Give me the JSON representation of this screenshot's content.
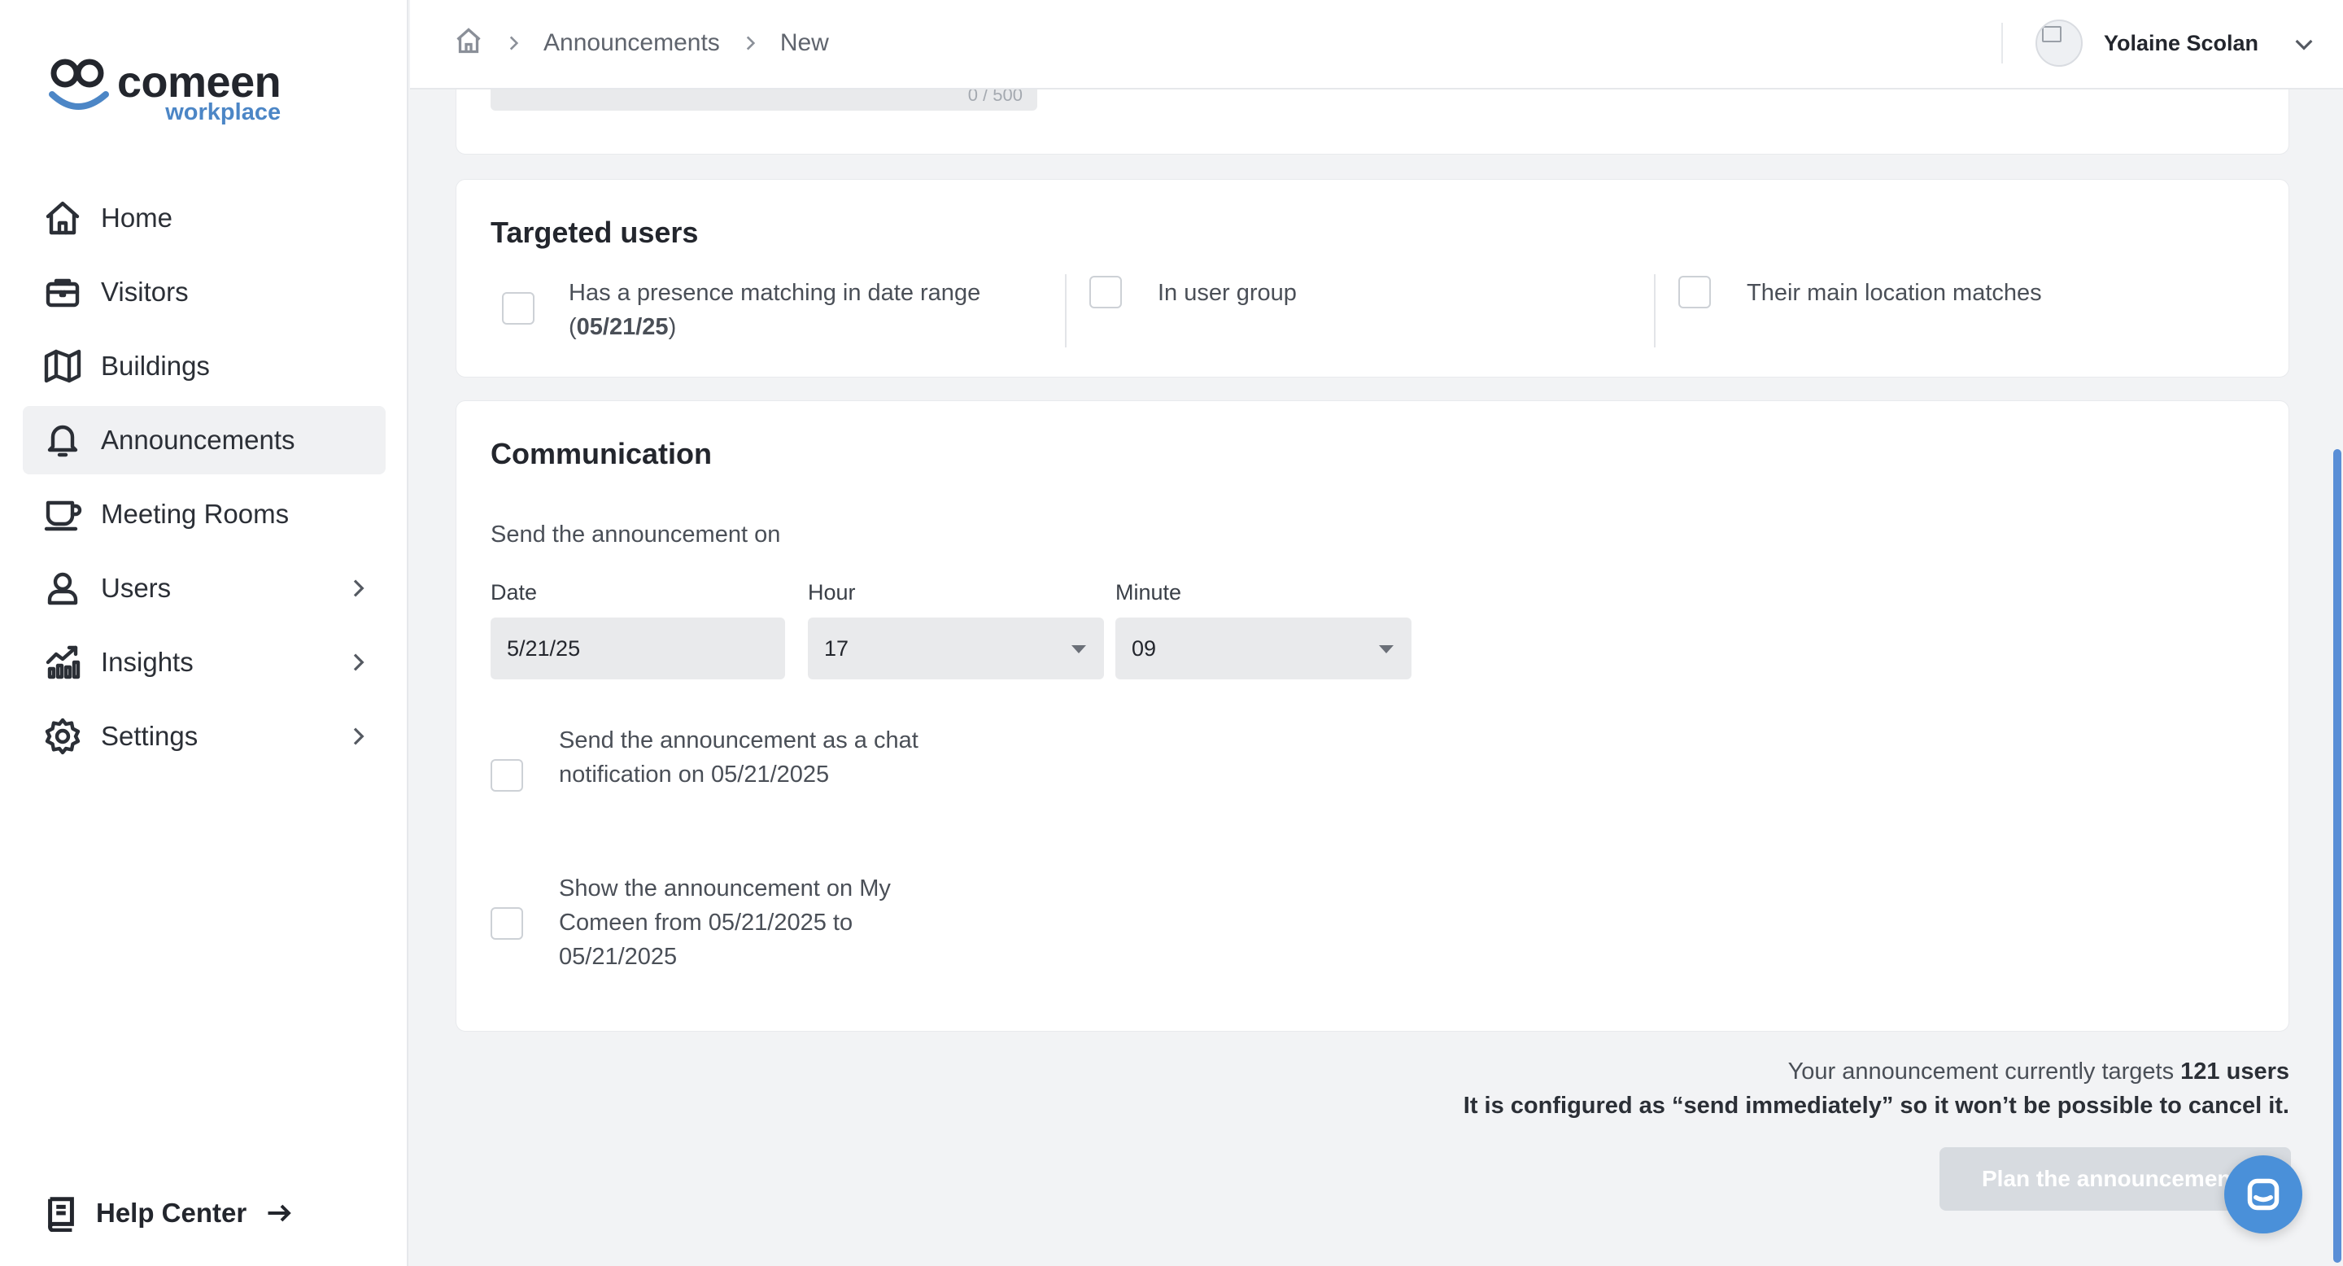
{
  "app": {
    "logo_main": "comeen",
    "logo_sub": "workplace",
    "accent_color": "#4c86c6"
  },
  "sidebar": {
    "items": [
      {
        "label": "Home",
        "icon": "home-icon"
      },
      {
        "label": "Visitors",
        "icon": "briefcase-icon"
      },
      {
        "label": "Buildings",
        "icon": "map-icon"
      },
      {
        "label": "Announcements",
        "icon": "bell-icon",
        "active": true
      },
      {
        "label": "Meeting Rooms",
        "icon": "cup-icon"
      },
      {
        "label": "Users",
        "icon": "user-icon",
        "expandable": true
      },
      {
        "label": "Insights",
        "icon": "chart-icon",
        "expandable": true
      },
      {
        "label": "Settings",
        "icon": "gear-icon",
        "expandable": true
      }
    ],
    "help_label": "Help Center"
  },
  "topbar": {
    "breadcrumb": [
      "Announcements",
      "New"
    ],
    "user_name": "Yolaine Scolan"
  },
  "message_card": {
    "char_counter": "0 / 500"
  },
  "targeted_users": {
    "title": "Targeted users",
    "option_presence_line1": "Has a presence matching in date range",
    "option_presence_line2_open": "(",
    "option_presence_date": "05/21/25",
    "option_presence_line2_close": ")",
    "option_group": "In user group",
    "option_location": "Their main location matches"
  },
  "communication": {
    "title": "Communication",
    "send_on_label": "Send the announcement on",
    "date_label": "Date",
    "date_value": "5/21/25",
    "hour_label": "Hour",
    "hour_value": "17",
    "minute_label": "Minute",
    "minute_value": "09",
    "chat_notification_label": "Send the announcement as a chat notification on 05/21/2025",
    "my_comeen_label": "Show the announcement on My Comeen from 05/21/2025 to 05/21/2025"
  },
  "footer": {
    "targets_prefix": "Your announcement currently targets ",
    "targets_count": "121 users",
    "warning": "It is configured as “send immediately” so it won’t be possible to cancel it.",
    "plan_button": "Plan the announcement"
  }
}
